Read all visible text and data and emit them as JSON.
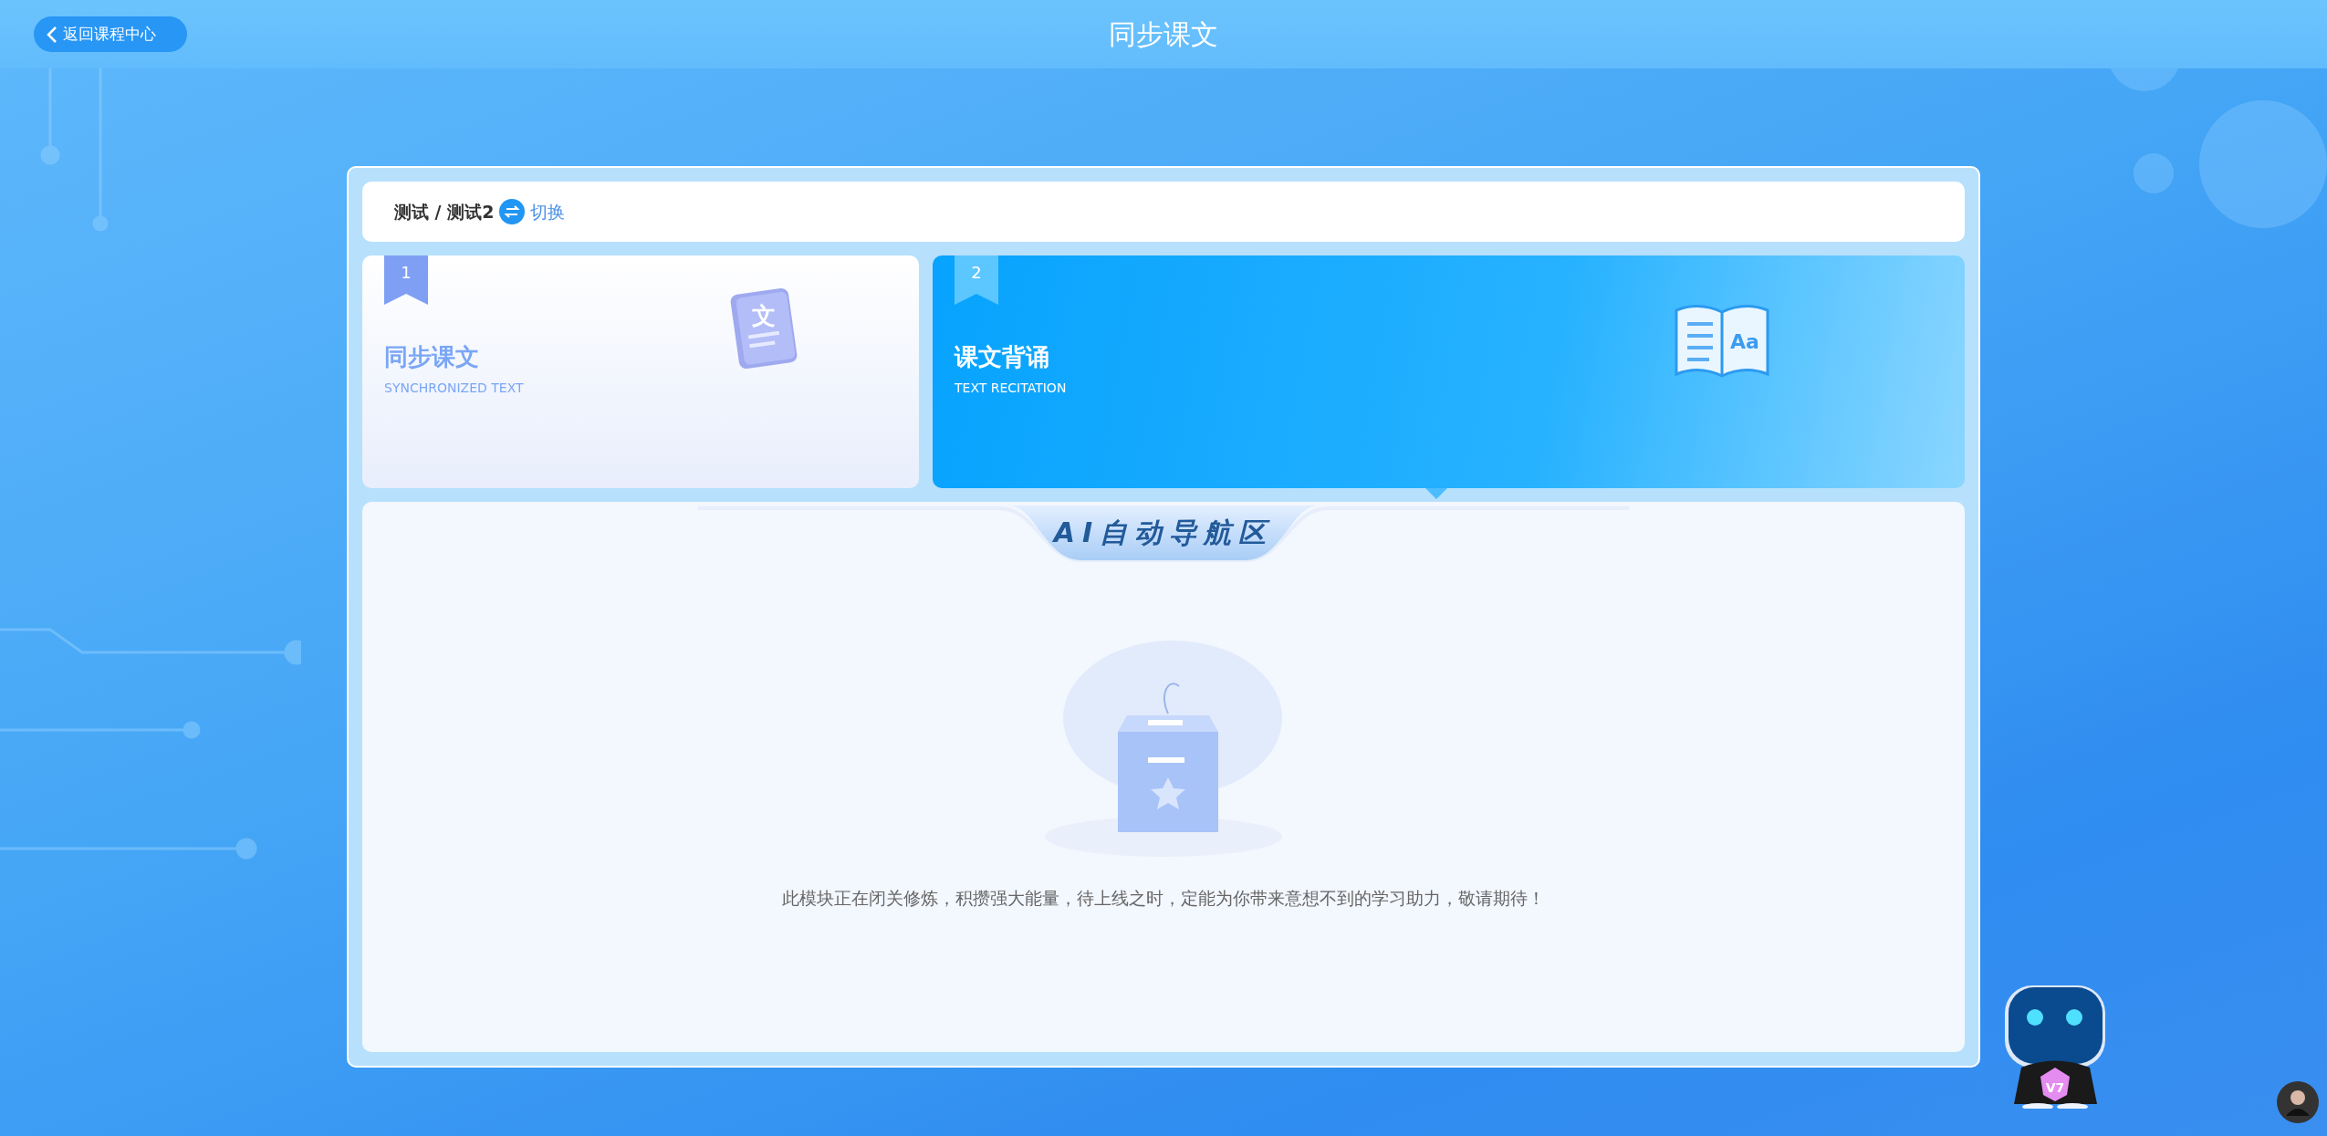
{
  "header": {
    "back_button": "返回课程中心",
    "title": "同步课文"
  },
  "breadcrumb": {
    "path": "测试 / 测试2",
    "switch_link": "切换"
  },
  "cards": [
    {
      "number": "1",
      "title": "同步课文",
      "subtitle": "SYNCHRONIZED TEXT",
      "glyph": "文",
      "selected": false
    },
    {
      "number": "2",
      "title": "课文背诵",
      "subtitle": "TEXT RECITATION",
      "glyph": "Aa",
      "selected": true
    }
  ],
  "ai_zone": {
    "title": "AI自动导航区",
    "message": "此模块正在闭关修炼，积攒强大能量，待上线之时，定能为你带来意想不到的学习助力，敬请期待！"
  },
  "mascot": {
    "badge": "V7"
  }
}
